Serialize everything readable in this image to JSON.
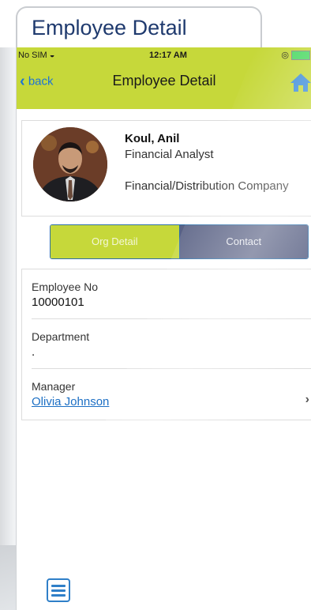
{
  "caption": {
    "title": "Employee Detail"
  },
  "status_bar": {
    "carrier": "No SIM",
    "time": "12:17 AM"
  },
  "nav": {
    "back_label": "back",
    "title": "Employee Detail"
  },
  "employee": {
    "name": "Koul, Anil",
    "job_title": "Financial Analyst",
    "company": "Financial/Distribution Company"
  },
  "tabs": [
    {
      "label": "Org Detail",
      "active": true
    },
    {
      "label": "Contact",
      "active": false
    }
  ],
  "details": [
    {
      "label": "Employee No",
      "value": "10000101"
    },
    {
      "label": "Department",
      "value": "."
    },
    {
      "label": "Manager",
      "value": "Olivia Johnson"
    }
  ],
  "colors": {
    "accent": "#c6d83a",
    "tab_inactive": "#5a6285",
    "link": "#1c6fc4"
  },
  "icons": [
    "wifi-icon",
    "back-chevron-icon",
    "home-icon",
    "chevron-right-icon",
    "hamburger-menu-icon",
    "battery-icon"
  ]
}
